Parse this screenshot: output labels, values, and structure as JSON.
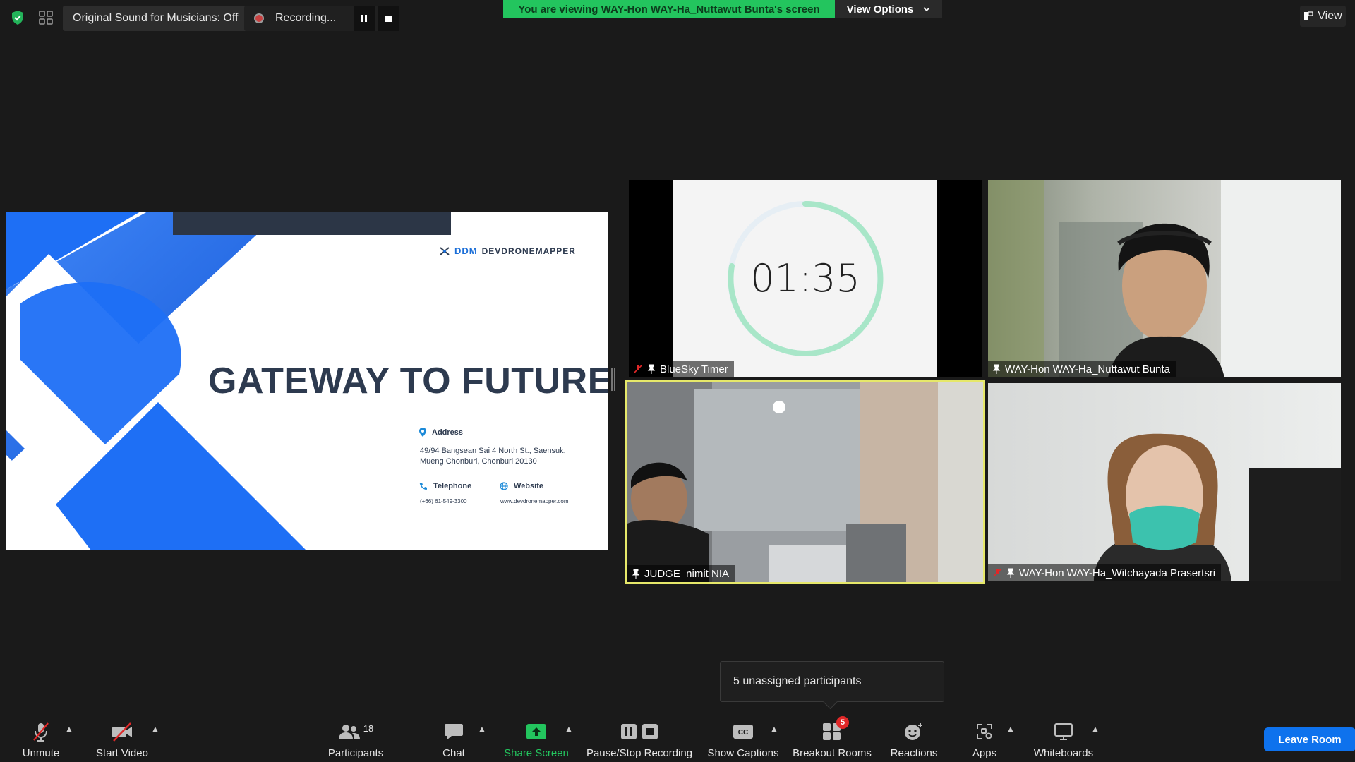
{
  "top": {
    "original_sound": "Original Sound for Musicians: Off",
    "recording": "Recording...",
    "banner": "You are viewing WAY-Hon WAY-Ha_Nuttawut Bunta's screen",
    "view_options": "View Options",
    "view": "View"
  },
  "slide": {
    "title": "GATEWAY TO FUTURE",
    "logo_mark": "DDM",
    "logo_text": "DEVDRONEMAPPER",
    "address_head": "Address",
    "address_line1": "49/94 Bangsean Sai 4 North St., Saensuk,",
    "address_line2": "Mueng Chonburi, Chonburi 20130",
    "telephone_head": "Telephone",
    "telephone": "(+66) 61-549-3300",
    "website_head": "Website",
    "website": "www.devdronemapper.com"
  },
  "tiles": {
    "timer_value": "01:35",
    "timer_name": "BlueSky Timer",
    "nuttawut_name": "WAY-Hon WAY-Ha_Nuttawut Bunta",
    "judge_name": "JUDGE_nimit NIA",
    "witchayada_name": "WAY-Hon WAY-Ha_Witchayada Prasertsri"
  },
  "tooltip": "5 unassigned participants",
  "toolbar": {
    "unmute": "Unmute",
    "start_video": "Start Video",
    "participants": "Participants",
    "participants_count": "18",
    "chat": "Chat",
    "share_screen": "Share Screen",
    "pause_stop": "Pause/Stop Recording",
    "show_captions": "Show Captions",
    "breakout": "Breakout Rooms",
    "breakout_badge": "5",
    "reactions": "Reactions",
    "apps": "Apps",
    "whiteboards": "Whiteboards",
    "leave_room": "Leave Room"
  },
  "colors": {
    "banner_green": "#23c55e",
    "leave_blue": "#0e72ed",
    "active_speaker_border": "#e6e86a",
    "slide_blue": "#1e6ff5",
    "timer_ring": "#a8e6c8"
  }
}
